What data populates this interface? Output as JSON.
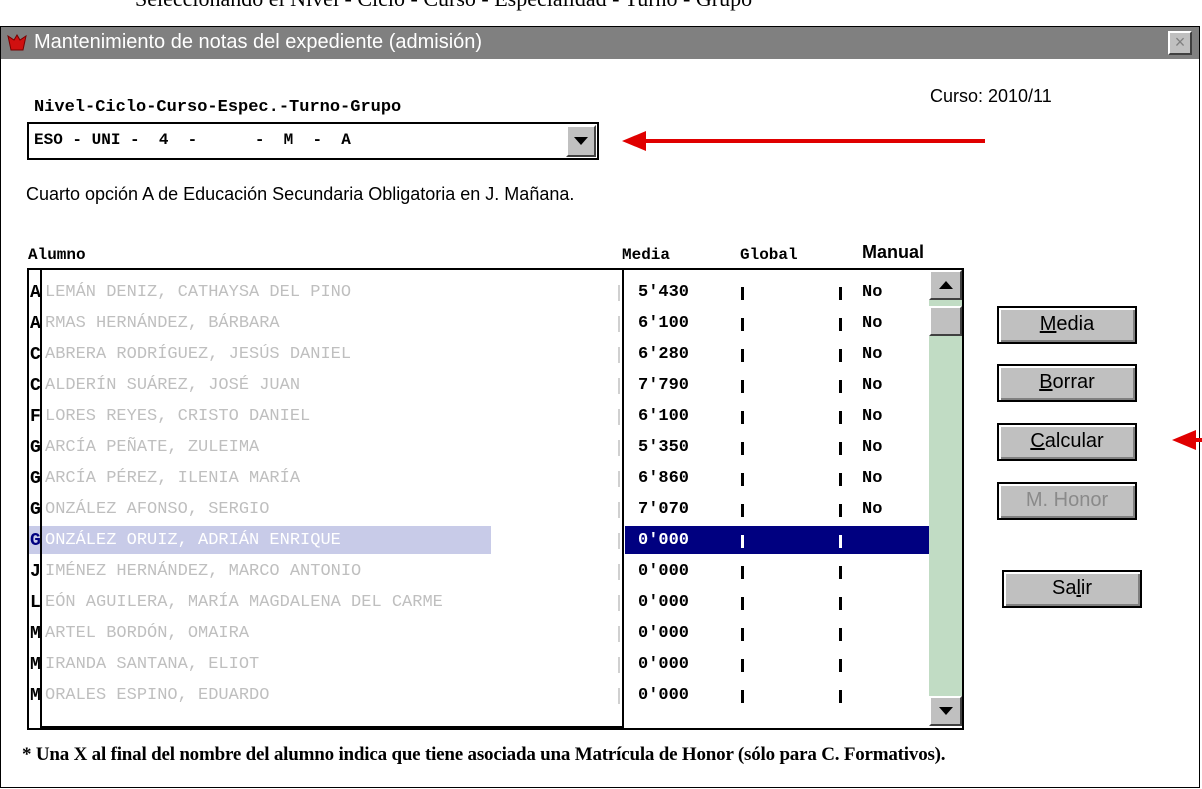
{
  "document": {
    "caption": "Seleccionando el Nivel - Ciclo - Curso - Especialidad - Turno - Grupo"
  },
  "window": {
    "title": "Mantenimiento de notas del expediente (admisión)",
    "close_label": "×"
  },
  "selector": {
    "label": "Nivel-Ciclo-Curso-Espec.-Turno-Grupo",
    "value": "ESO - UNI -  4  -      -  M  -  A"
  },
  "curso": {
    "text": "Curso:  2010/11"
  },
  "description": "Cuarto opción A  de Educación Secundaria Obligatoria en J. Mañana.",
  "table": {
    "headers": {
      "alumno": "Alumno",
      "media": "Media",
      "global": "Global",
      "manual": "Manual"
    },
    "rows": [
      {
        "initial": "A",
        "rest": "LEMÁN DENIZ, CATHAYSA DEL PINO",
        "media": "5'430",
        "manual": "No"
      },
      {
        "initial": "A",
        "rest": "RMAS HERNÁNDEZ, BÁRBARA",
        "media": "6'100",
        "manual": "No"
      },
      {
        "initial": "C",
        "rest": "ABRERA RODRÍGUEZ, JESÚS DANIEL",
        "media": "6'280",
        "manual": "No"
      },
      {
        "initial": "C",
        "rest": "ALDERÍN SUÁREZ, JOSÉ JUAN",
        "media": "7'790",
        "manual": "No"
      },
      {
        "initial": "F",
        "rest": "LORES REYES, CRISTO DANIEL",
        "media": "6'100",
        "manual": "No"
      },
      {
        "initial": "G",
        "rest": "ARCÍA PEÑATE, ZULEIMA",
        "media": "5'350",
        "manual": "No"
      },
      {
        "initial": "G",
        "rest": "ARCÍA PÉREZ, ILENIA MARÍA",
        "media": "6'860",
        "manual": "No"
      },
      {
        "initial": "G",
        "rest": "ONZÁLEZ AFONSO, SERGIO",
        "media": "7'070",
        "manual": "No"
      },
      {
        "initial": "G",
        "rest": "ONZÁLEZ ORUIZ, ADRIÁN ENRIQUE",
        "media": "0'000",
        "manual": "",
        "selected": true
      },
      {
        "initial": "J",
        "rest": "IMÉNEZ HERNÁNDEZ, MARCO ANTONIO",
        "media": "0'000",
        "manual": ""
      },
      {
        "initial": "L",
        "rest": "EÓN AGUILERA, MARÍA MAGDALENA DEL CARME",
        "media": "0'000",
        "manual": ""
      },
      {
        "initial": "M",
        "rest": "ARTEL BORDÓN, OMAIRA",
        "media": "0'000",
        "manual": ""
      },
      {
        "initial": "M",
        "rest": "IRANDA SANTANA, ELIOT",
        "media": "0'000",
        "manual": ""
      },
      {
        "initial": "M",
        "rest": "ORALES ESPINO, EDUARDO",
        "media": "0'000",
        "manual": ""
      }
    ]
  },
  "buttons": {
    "media": {
      "mnemonic": "M",
      "rest": "edia"
    },
    "borrar": {
      "mnemonic": "B",
      "rest": "orrar"
    },
    "calcular": {
      "mnemonic": "C",
      "rest": "alcular"
    },
    "mhonor": {
      "label": "M. Honor"
    },
    "salir": {
      "pre": "Sa",
      "mnemonic": "l",
      "rest": "ir"
    }
  },
  "footnote": "* Una X al final del nombre del alumno indica que tiene asociada una Matrícula de Honor (sólo  para C. Formativos).",
  "colors": {
    "titlebar": "#808080",
    "selection": "#000080",
    "scrollbar_track": "#c1dcc4",
    "annotation_arrow": "#e00000"
  }
}
